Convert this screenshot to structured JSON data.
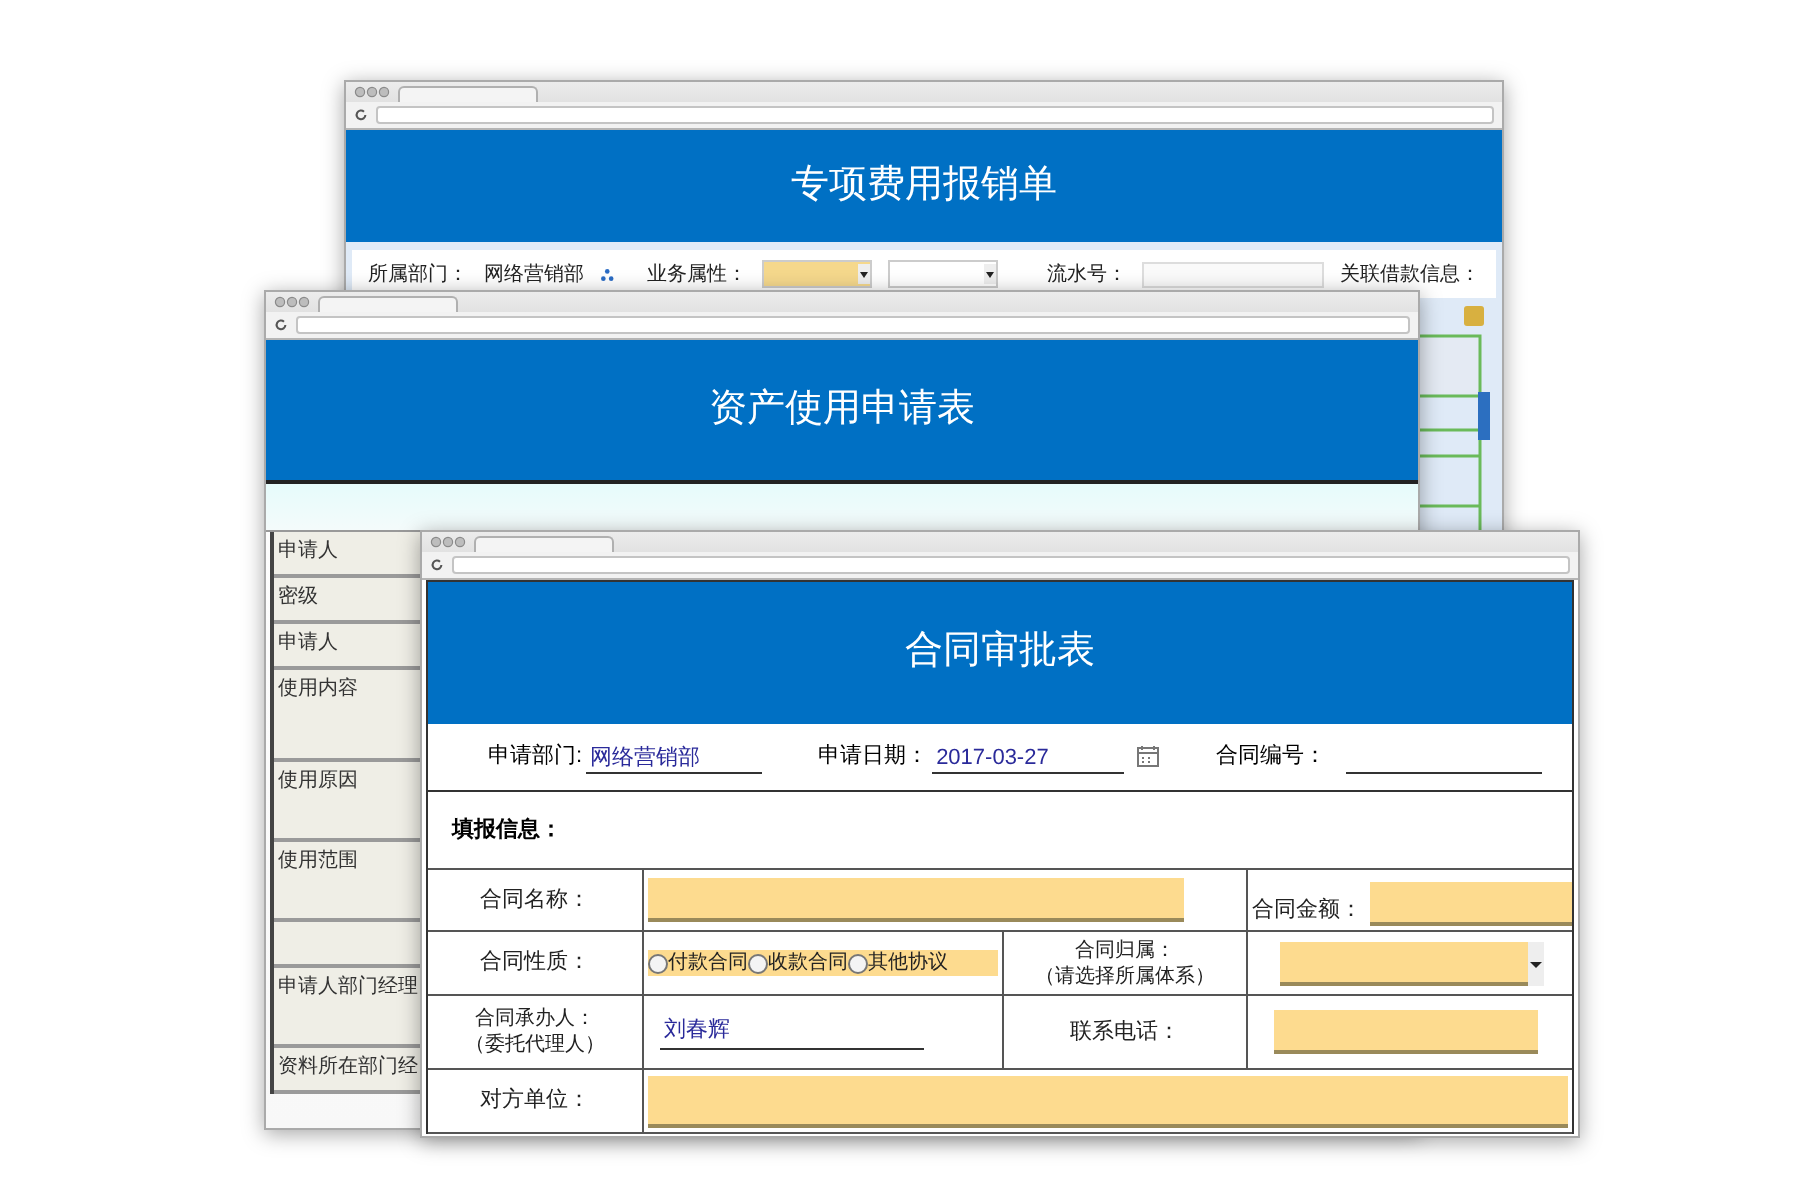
{
  "expense_window": {
    "title": "专项费用报销单",
    "fields": [
      {
        "kind": "text",
        "label": "所属部门：",
        "value": "网络营销部"
      },
      {
        "kind": "select",
        "label": "业务属性：",
        "highlighted": true
      },
      {
        "kind": "select",
        "highlighted": false
      },
      {
        "kind": "input",
        "label": "流水号："
      },
      {
        "kind": "label",
        "label": "关联借款信息："
      }
    ]
  },
  "asset_window": {
    "title": "资产使用申请表",
    "row_labels": [
      {
        "kind": "label",
        "label": "申请人"
      },
      {
        "kind": "label",
        "label": "密级"
      },
      {
        "kind": "label",
        "label": "申请人"
      },
      {
        "kind": "label",
        "label": "使用内容"
      },
      {
        "kind": "label",
        "label": "使用原因"
      },
      {
        "kind": "label",
        "label": "使用范围"
      },
      {
        "kind": "blank"
      },
      {
        "kind": "label",
        "label": "申请人部门经理"
      },
      {
        "kind": "label",
        "label": "资料所在部门经"
      }
    ]
  },
  "contract_window": {
    "title": "合同审批表",
    "header_fields": [
      {
        "kind": "text",
        "label": "申请部门:",
        "value": "网络营销部"
      },
      {
        "kind": "date",
        "label": "申请日期：",
        "value": "2017-03-27"
      },
      {
        "kind": "text",
        "label": "合同编号："
      }
    ],
    "section": "填报信息：",
    "name_label": "合同名称：",
    "amount_label": "合同金额：",
    "type_label": "合同性质：",
    "type_options": [
      {
        "label": "付款合同",
        "selected": false
      },
      {
        "label": "收款合同",
        "selected": false
      },
      {
        "label": "其他协议",
        "selected": false
      }
    ],
    "owner_label": [
      "合同归属：",
      "（请选择所属体系）"
    ],
    "handler_label": [
      "合同承办人：",
      "（委托代理人）"
    ],
    "handler_value": "刘春辉",
    "phone_label": "联系电话：",
    "party_label": "对方单位："
  }
}
